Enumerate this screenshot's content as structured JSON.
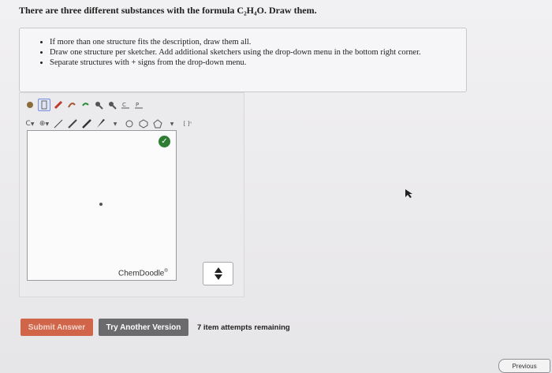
{
  "question": "There are three different substances with the formula C₂H₄O. Draw them.",
  "instructions": [
    "If more than one structure fits the description, draw them all.",
    "Draw one structure per sketcher. Add additional sketchers using the drop-down menu in the bottom right corner.",
    "Separate structures with + signs from the drop-down menu."
  ],
  "sketcher": {
    "toolbar_row1_icons": [
      "atom-icon",
      "select-icon",
      "eraser-icon",
      "lasso-icon",
      "undo-icon",
      "zoom-in-icon",
      "zoom-out-icon",
      "clean-icon",
      "template-icon"
    ],
    "toolbar_row2_icons": [
      "element-dropdown",
      "charge-dropdown",
      "single-bond",
      "double-bond",
      "triple-bond",
      "wedge-bond",
      "bond-dropdown",
      "ring-3",
      "ring-6",
      "ring-5",
      "ring-dropdown",
      "bracket-tool"
    ],
    "element_label": "C",
    "bracket_label": "[ ]ⁿ",
    "brand": "ChemDoodle",
    "brand_mark": "®"
  },
  "buttons": {
    "submit": "Submit Answer",
    "try_another": "Try Another Version"
  },
  "attempts": "7 item attempts remaining",
  "nav": {
    "previous": "Previous"
  },
  "colors": {
    "submit": "#d0654a",
    "try": "#6b6b6e",
    "ok": "#2e7d32"
  }
}
